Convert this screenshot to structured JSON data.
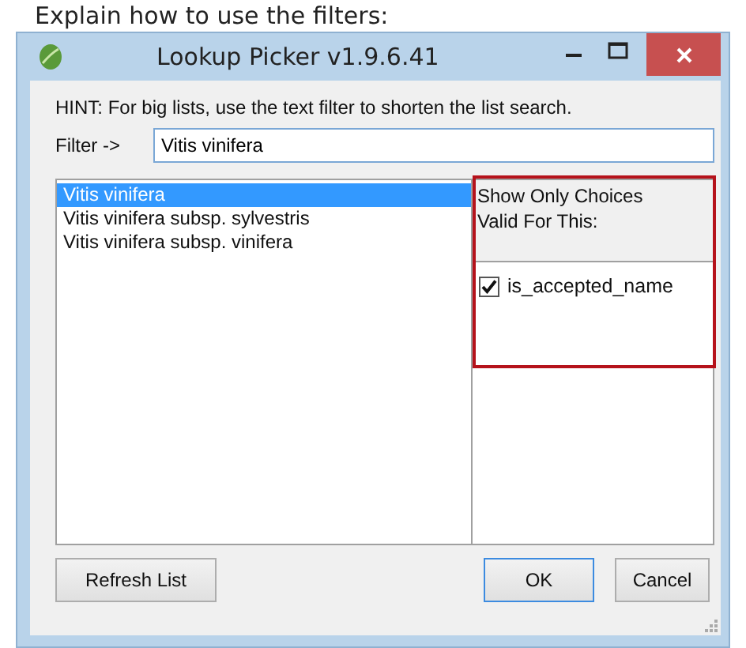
{
  "caption": "Explain how to use the filters:",
  "window": {
    "title": "Lookup Picker v1.9.6.41"
  },
  "hint": "HINT: For big lists, use the text filter to shorten the list search.",
  "filter": {
    "label": "Filter ->",
    "value": "Vitis vinifera"
  },
  "results": [
    {
      "text": "Vitis vinifera",
      "selected": true
    },
    {
      "text": "Vitis vinifera subsp. sylvestris",
      "selected": false
    },
    {
      "text": "Vitis vinifera subsp. vinifera",
      "selected": false
    }
  ],
  "valid_for": {
    "heading_lines": [
      "Show Only Choices",
      "Valid For This:"
    ],
    "options": [
      {
        "label": "is_accepted_name",
        "checked": true
      }
    ]
  },
  "buttons": {
    "refresh": "Refresh List",
    "ok": "OK",
    "cancel": "Cancel"
  }
}
